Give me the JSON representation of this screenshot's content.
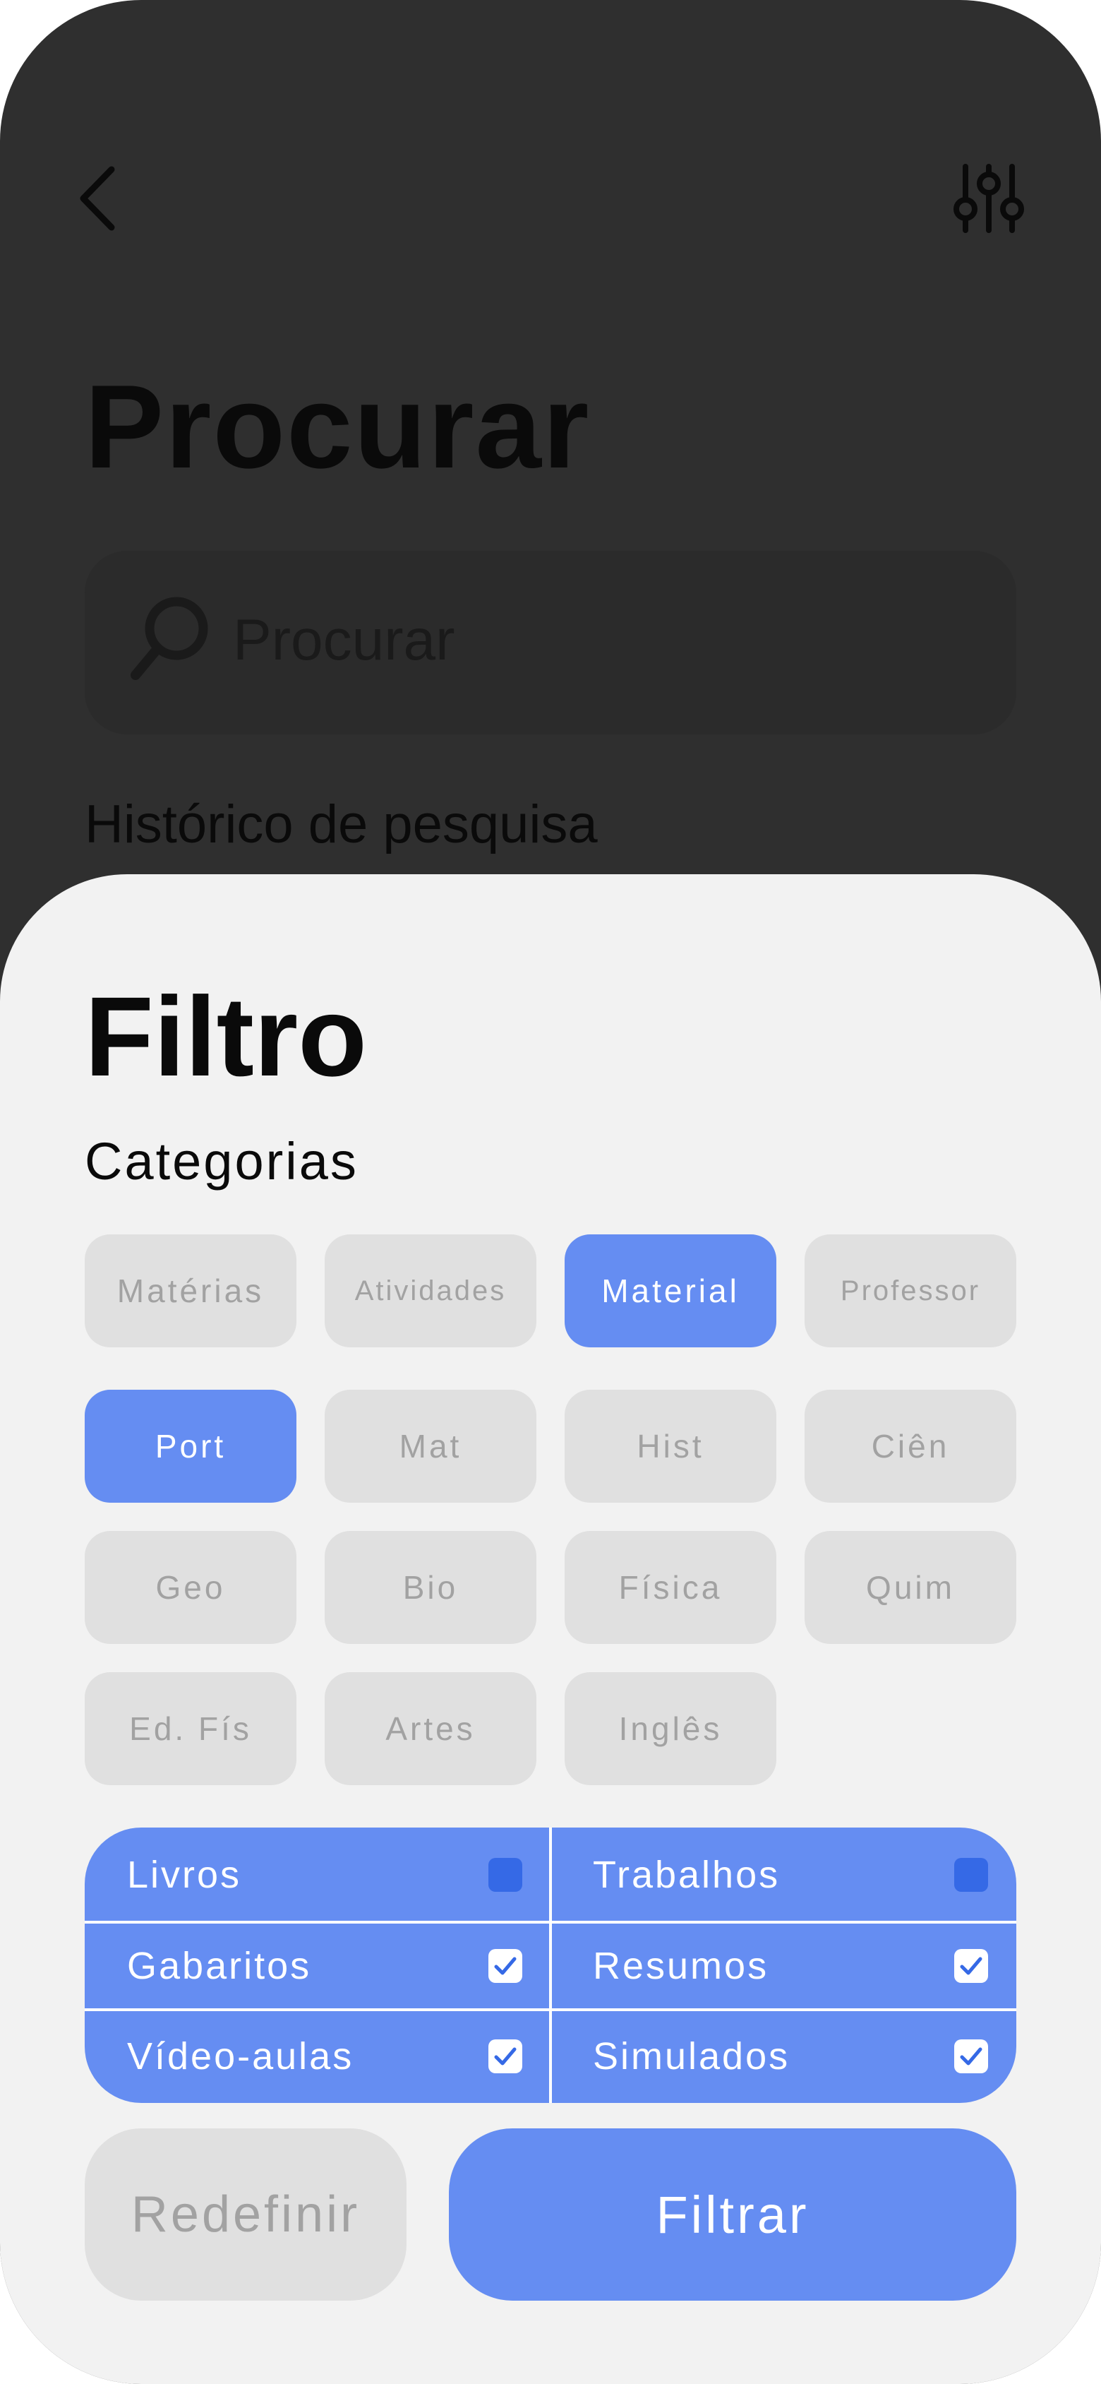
{
  "header": {
    "back_icon": "chevron-left-icon",
    "filter_icon": "sliders-icon",
    "title": "Procurar"
  },
  "search": {
    "icon": "search-icon",
    "placeholder": "Procurar"
  },
  "history": {
    "label": "Histórico de pesquisa"
  },
  "filter_sheet": {
    "title": "Filtro",
    "categories_label": "Categorias",
    "categories": [
      {
        "label": "Matérias",
        "selected": false
      },
      {
        "label": "Atividades",
        "selected": false
      },
      {
        "label": "Material",
        "selected": true
      },
      {
        "label": "Professor",
        "selected": false
      }
    ],
    "subjects": [
      {
        "label": "Port",
        "selected": true
      },
      {
        "label": "Mat",
        "selected": false
      },
      {
        "label": "Hist",
        "selected": false
      },
      {
        "label": "Ciên",
        "selected": false
      },
      {
        "label": "Geo",
        "selected": false
      },
      {
        "label": "Bio",
        "selected": false
      },
      {
        "label": "Física",
        "selected": false
      },
      {
        "label": "Quim",
        "selected": false
      },
      {
        "label": "Ed. Fís",
        "selected": false
      },
      {
        "label": "Artes",
        "selected": false
      },
      {
        "label": "Inglês",
        "selected": false
      }
    ],
    "material_types": [
      {
        "label": "Livros",
        "checked": false
      },
      {
        "label": "Trabalhos",
        "checked": false
      },
      {
        "label": "Gabaritos",
        "checked": true
      },
      {
        "label": "Resumos",
        "checked": true
      },
      {
        "label": "Vídeo-aulas",
        "checked": true
      },
      {
        "label": "Simulados",
        "checked": true
      }
    ],
    "reset_label": "Redefinir",
    "apply_label": "Filtrar"
  },
  "colors": {
    "accent": "#658df2",
    "backdrop": "#2f2f2f",
    "sheet": "#f2f2f2",
    "chip_inactive": "#e0e0e0",
    "text_muted": "#a2a2a2"
  }
}
